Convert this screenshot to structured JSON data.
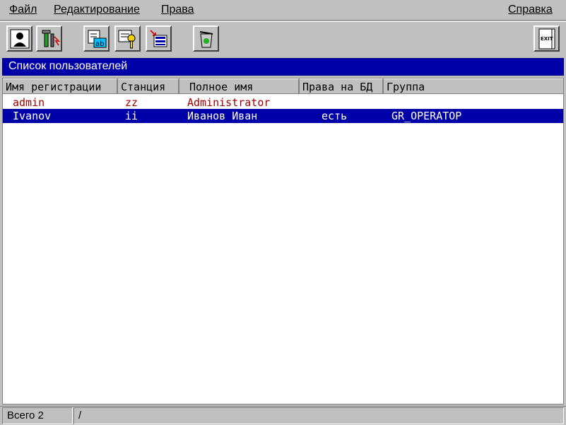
{
  "menu": {
    "file": "Файл",
    "edit": "Редактирование",
    "rights": "Права",
    "help": "Справка"
  },
  "toolbar": {
    "buttons": [
      {
        "icon": "user-portrait-icon"
      },
      {
        "icon": "tools-icon"
      },
      {
        "icon": "rename-ab-icon"
      },
      {
        "icon": "key-icon"
      },
      {
        "icon": "import-records-icon"
      },
      {
        "icon": "recycle-bin-icon"
      },
      {
        "icon": "exit-door-icon",
        "label": "EXIT"
      }
    ]
  },
  "list": {
    "title": "Список пользователей",
    "columns": [
      "Имя регистрации",
      "Станция",
      "Полное имя",
      "Права на БД",
      "Группа"
    ],
    "rows": [
      {
        "login": "admin",
        "station": "zz",
        "full_name": "Administrator",
        "db_rights": "",
        "group": ""
      },
      {
        "login": "Ivanov",
        "station": "ii",
        "full_name": "Иванов Иван",
        "db_rights": "есть",
        "group": "GR_OPERATOP"
      }
    ],
    "selected_row": 1
  },
  "status": {
    "total": "Всего 2",
    "path": "/"
  },
  "colors": {
    "selection": "#0000a8",
    "admin_text": "#a00000",
    "background": "#c0c0c0"
  }
}
